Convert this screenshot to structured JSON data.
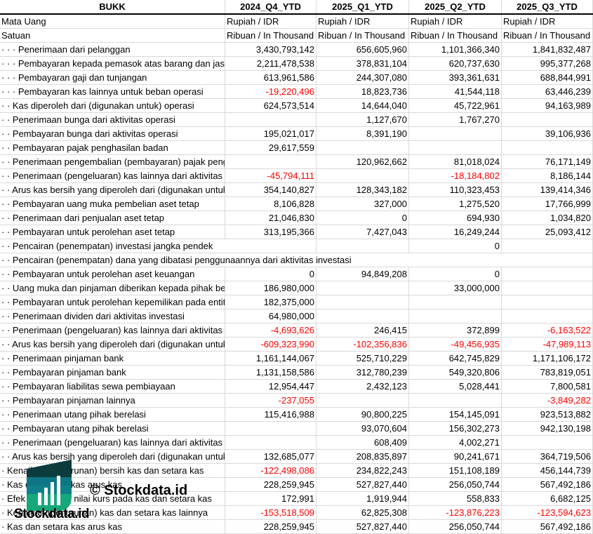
{
  "header": {
    "ticker": "BUKK",
    "periods": [
      "2024_Q4_YTD",
      "2025_Q1_YTD",
      "2025_Q2_YTD",
      "2025_Q3_YTD"
    ]
  },
  "meta_rows": [
    {
      "label": "Mata Uang",
      "values": [
        "Rupiah / IDR",
        "Rupiah / IDR",
        "Rupiah / IDR",
        "Rupiah / IDR"
      ]
    },
    {
      "label": "Satuan",
      "values": [
        "Ribuan / In Thousand",
        "Ribuan / In Thousand",
        "Ribuan / In Thousand",
        "Ribuan / In Thousand"
      ]
    }
  ],
  "rows": [
    {
      "label": "· · · Penerimaan dari pelanggan",
      "values": [
        "3,430,793,142",
        "656,605,960",
        "1,101,366,340",
        "1,841,832,487"
      ]
    },
    {
      "label": "· · · Pembayaran kepada pemasok atas barang dan jasa",
      "values": [
        "2,211,478,538",
        "378,831,104",
        "620,737,630",
        "995,377,268"
      ]
    },
    {
      "label": "· · · Pembayaran gaji dan tunjangan",
      "values": [
        "613,961,586",
        "244,307,080",
        "393,361,631",
        "688,844,991"
      ]
    },
    {
      "label": "· · · Pembayaran kas lainnya untuk beban operasi",
      "values": [
        "-19,220,496",
        "18,823,736",
        "41,544,118",
        "63,446,239"
      ]
    },
    {
      "label": "· · Kas diperoleh dari (digunakan untuk) operasi",
      "values": [
        "624,573,514",
        "14,644,040",
        "45,722,961",
        "94,163,989"
      ]
    },
    {
      "label": "· · Penerimaan bunga dari aktivitas operasi",
      "values": [
        "",
        "1,127,670",
        "1,767,270",
        ""
      ]
    },
    {
      "label": "· · Pembayaran bunga dari aktivitas operasi",
      "values": [
        "195,021,017",
        "8,391,190",
        "",
        "39,106,936"
      ]
    },
    {
      "label": "· · Pembayaran pajak penghasilan badan",
      "values": [
        "29,617,559",
        "",
        "",
        ""
      ]
    },
    {
      "label": "· · Penerimaan pengembalian (pembayaran) pajak penghasilan dari aktivitas operasi",
      "values": [
        "",
        "120,962,662",
        "81,018,024",
        "76,171,149"
      ]
    },
    {
      "label": "· · Penerimaan (pengeluaran) kas lainnya dari aktivitas operasi",
      "values": [
        "-45,794,111",
        "",
        "-18,184,802",
        "8,186,144"
      ]
    },
    {
      "label": "· · Arus kas bersih yang diperoleh dari (digunakan untuk) aktivitas operasi",
      "values": [
        "354,140,827",
        "128,343,182",
        "110,323,453",
        "139,414,346"
      ]
    },
    {
      "label": "· · Pembayaran uang muka pembelian aset tetap",
      "values": [
        "8,106,828",
        "327,000",
        "1,275,520",
        "17,766,999"
      ]
    },
    {
      "label": "· · Penerimaan dari penjualan aset tetap",
      "values": [
        "21,046,830",
        "0",
        "694,930",
        "1,034,820"
      ]
    },
    {
      "label": "· · Pembayaran untuk perolehan aset tetap",
      "values": [
        "313,195,366",
        "7,427,043",
        "16,249,244",
        "25,093,412"
      ]
    },
    {
      "label": "· · Pencairan (penempatan) investasi jangka pendek",
      "values": [
        "",
        "",
        "0",
        ""
      ]
    },
    {
      "label": "· · Pencairan (penempatan) dana yang dibatasi penggunaannya dari aktivitas investasi",
      "values": [
        "",
        "",
        "",
        ""
      ]
    },
    {
      "label": "· · Pembayaran untuk perolehan aset keuangan",
      "values": [
        "0",
        "94,849,208",
        "0",
        ""
      ]
    },
    {
      "label": "· · Uang muka dan pinjaman diberikan kepada pihak berelasi",
      "values": [
        "186,980,000",
        "",
        "33,000,000",
        ""
      ]
    },
    {
      "label": "· · Pembayaran untuk perolehan kepemilikan pada entitas",
      "values": [
        "182,375,000",
        "",
        "",
        ""
      ]
    },
    {
      "label": "· · Penerimaan dividen dari aktivitas investasi",
      "values": [
        "64,980,000",
        "",
        "",
        ""
      ]
    },
    {
      "label": "· · Penerimaan (pengeluaran) kas lainnya dari aktivitas investasi",
      "values": [
        "-4,693,626",
        "246,415",
        "372,899",
        "-6,163,522"
      ]
    },
    {
      "label": "· · Arus kas bersih yang diperoleh dari (digunakan untuk) aktivitas investasi",
      "values": [
        "-609,323,990",
        "-102,356,836",
        "-49,456,935",
        "-47,989,113"
      ]
    },
    {
      "label": "· · Penerimaan pinjaman bank",
      "values": [
        "1,161,144,067",
        "525,710,229",
        "642,745,829",
        "1,171,106,172"
      ]
    },
    {
      "label": "· · Pembayaran pinjaman bank",
      "values": [
        "1,131,158,586",
        "312,780,239",
        "549,320,806",
        "783,819,051"
      ]
    },
    {
      "label": "· · Pembayaran liabilitas sewa pembiayaan",
      "values": [
        "12,954,447",
        "2,432,123",
        "5,028,441",
        "7,800,581"
      ]
    },
    {
      "label": "· · Pembayaran pinjaman lainnya",
      "values": [
        "-237,055",
        "",
        "",
        "-3,849,282"
      ]
    },
    {
      "label": "· · Penerimaan utang pihak berelasi",
      "values": [
        "115,416,988",
        "90,800,225",
        "154,145,091",
        "923,513,882"
      ]
    },
    {
      "label": "· · Pembayaran utang pihak berelasi",
      "values": [
        "",
        "93,070,604",
        "156,302,273",
        "942,130,198"
      ]
    },
    {
      "label": "· · Penerimaan (pengeluaran) kas lainnya dari aktivitas pendanaan",
      "values": [
        "",
        "608,409",
        "4,002,271",
        ""
      ]
    },
    {
      "label": "· · Arus kas bersih yang diperoleh dari (digunakan untuk) aktivitas pendanaan",
      "values": [
        "132,685,077",
        "208,835,897",
        "90,241,671",
        "364,719,506"
      ]
    },
    {
      "label": "· Kenaikan (penurunan) bersih kas dan setara kas",
      "values": [
        "-122,498,086",
        "234,822,243",
        "151,108,189",
        "456,144,739"
      ]
    },
    {
      "label": "· Kas dan setara kas arus kas",
      "values": [
        "228,259,945",
        "527,827,440",
        "256,050,744",
        "567,492,186"
      ]
    },
    {
      "label": "· Efek perubahan nilai kurs pada kas dan setara kas",
      "values": [
        "172,991",
        "1,919,944",
        "558,833",
        "6,682,125"
      ]
    },
    {
      "label": "· Kenaikan (penurunan) kas dan setara kas lainnya",
      "values": [
        "-153,518,509",
        "62,825,308",
        "-123,876,223",
        "-123,594,623"
      ]
    },
    {
      "label": "· Kas dan setara kas arus kas",
      "values": [
        "228,259,945",
        "527,827,440",
        "256,050,744",
        "567,492,186"
      ]
    }
  ],
  "watermark": {
    "copyright": "© Stockdata.id",
    "brand": "Stockdata.id"
  },
  "colors": {
    "negative": "#ff0000",
    "grid": "#d9d9d9",
    "logo_dark": "#0b3b3c",
    "logo_teal": "#0e7c8c",
    "logo_green": "#16a77a"
  }
}
